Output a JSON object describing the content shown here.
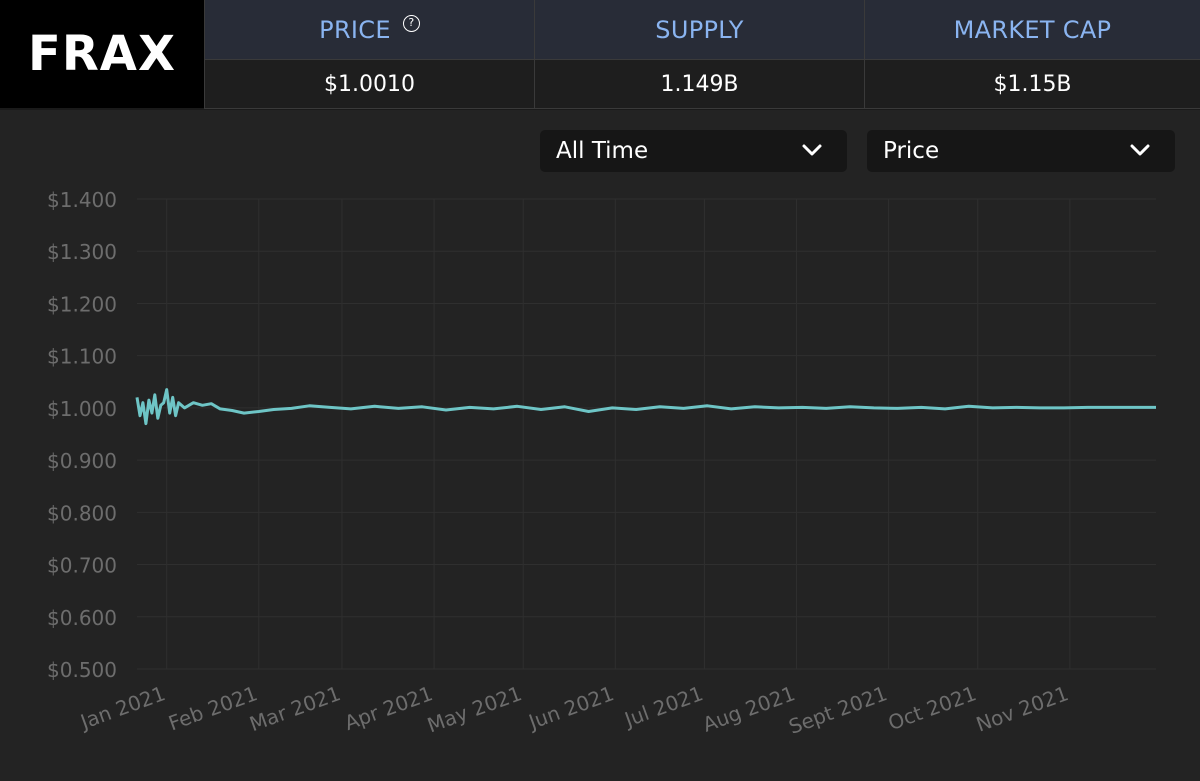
{
  "brand": {
    "name": "FRAX"
  },
  "stats": {
    "price": {
      "label": "PRICE",
      "value": "$1.0010",
      "help_icon": "question-circle-icon"
    },
    "supply": {
      "label": "SUPPLY",
      "value": "1.149B"
    },
    "market_cap": {
      "label": "MARKET CAP",
      "value": "$1.15B"
    }
  },
  "controls": {
    "range": {
      "selected": "All Time"
    },
    "metric": {
      "selected": "Price"
    }
  },
  "colors": {
    "accent": "#8ab4f0",
    "line": "#6ec5c6",
    "background": "#232323"
  },
  "chart_data": {
    "type": "line",
    "y_ticks": [
      "$1.400",
      "$1.300",
      "$1.200",
      "$1.100",
      "$1.000",
      "$0.900",
      "$0.800",
      "$0.700",
      "$0.600",
      "$0.500"
    ],
    "x_ticks": [
      "Jan 2021",
      "Feb 2021",
      "Mar 2021",
      "Apr 2021",
      "May 2021",
      "Jun 2021",
      "Jul 2021",
      "Aug 2021",
      "Sept 2021",
      "Oct 2021",
      "Nov 2021"
    ],
    "ylim": [
      0.5,
      1.4
    ],
    "xlim": [
      "2020-12-22",
      "2021-11-30"
    ],
    "grid": true,
    "series": [
      {
        "x": [
          "2020-12-22",
          "2020-12-23",
          "2020-12-24",
          "2020-12-25",
          "2020-12-26",
          "2020-12-27",
          "2020-12-28",
          "2020-12-29",
          "2020-12-30",
          "2020-12-31",
          "2021-01-01",
          "2021-01-02",
          "2021-01-03",
          "2021-01-04",
          "2021-01-05",
          "2021-01-07",
          "2021-01-10",
          "2021-01-13",
          "2021-01-16",
          "2021-01-19",
          "2021-01-23",
          "2021-01-27",
          "2021-02-01",
          "2021-02-06",
          "2021-02-12",
          "2021-02-18",
          "2021-02-25",
          "2021-03-04",
          "2021-03-12",
          "2021-03-20",
          "2021-03-28",
          "2021-04-05",
          "2021-04-13",
          "2021-04-21",
          "2021-04-29",
          "2021-05-07",
          "2021-05-15",
          "2021-05-23",
          "2021-05-31",
          "2021-06-08",
          "2021-06-16",
          "2021-06-24",
          "2021-07-02",
          "2021-07-10",
          "2021-07-18",
          "2021-07-26",
          "2021-08-03",
          "2021-08-11",
          "2021-08-19",
          "2021-08-27",
          "2021-09-04",
          "2021-09-12",
          "2021-09-20",
          "2021-09-28",
          "2021-10-06",
          "2021-10-14",
          "2021-10-22",
          "2021-10-30",
          "2021-11-07",
          "2021-11-15",
          "2021-11-23",
          "2021-11-30"
        ],
        "y": [
          1.02,
          0.985,
          1.01,
          0.97,
          1.015,
          0.99,
          1.025,
          0.98,
          1.005,
          1.01,
          1.035,
          0.99,
          1.02,
          0.985,
          1.01,
          1.0,
          1.01,
          1.005,
          1.008,
          0.998,
          0.995,
          0.99,
          0.993,
          0.997,
          0.999,
          1.004,
          1.001,
          0.998,
          1.003,
          0.999,
          1.002,
          0.996,
          1.001,
          0.998,
          1.003,
          0.997,
          1.002,
          0.993,
          1.0,
          0.997,
          1.002,
          0.999,
          1.004,
          0.998,
          1.002,
          1.0,
          1.001,
          0.999,
          1.002,
          1.0,
          0.999,
          1.001,
          0.998,
          1.003,
          1.0,
          1.001,
          1.0,
          1.0,
          1.001,
          1.001,
          1.001,
          1.001
        ]
      }
    ]
  }
}
